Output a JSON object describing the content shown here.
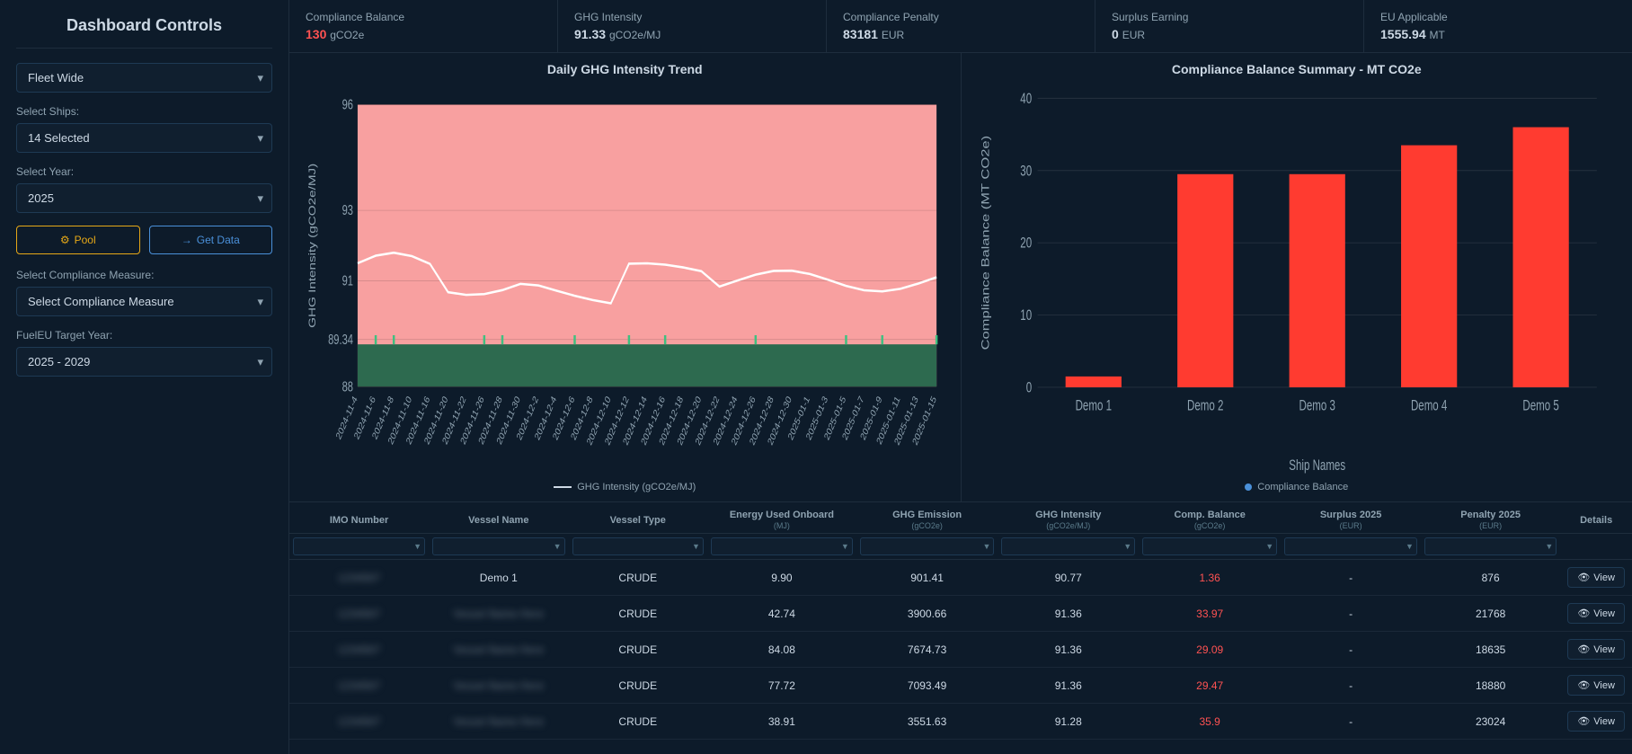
{
  "sidebar": {
    "title": "Dashboard Controls",
    "fleet_label": "Fleet Wide",
    "ships_label": "Select Ships:",
    "ships_value": "14 Selected",
    "year_label": "Select Year:",
    "year_value": "2025",
    "btn_pool": "Pool",
    "btn_getdata": "Get Data",
    "compliance_label": "Select Compliance Measure:",
    "compliance_placeholder": "Select Compliance Measure",
    "fueleu_label": "FuelEU Target Year:",
    "fueleu_value": "2025 - 2029"
  },
  "kpis": [
    {
      "title": "Compliance Balance",
      "value": "130",
      "value_color": "red",
      "unit": "gCO2e"
    },
    {
      "title": "GHG Intensity",
      "value": "91.33",
      "value_color": "normal",
      "unit": "gCO2e/MJ"
    },
    {
      "title": "Compliance Penalty",
      "value": "83181",
      "value_color": "normal",
      "unit": "EUR"
    },
    {
      "title": "Surplus Earning",
      "value": "0",
      "value_color": "normal",
      "unit": "EUR"
    },
    {
      "title": "EU Applicable",
      "value": "1555.94",
      "value_color": "normal",
      "unit": "MT"
    }
  ],
  "chart1": {
    "title": "Daily GHG Intensity Trend",
    "legend": "GHG Intensity (gCO2e/MJ)",
    "y_axis_label": "GHG Intensity (gCO2e/MJ)",
    "y_values": [
      96,
      93,
      91,
      89.34,
      88
    ],
    "x_dates": [
      "2024-11-4",
      "2024-11-6",
      "2024-11-8",
      "2024-11-10",
      "2024-11-16",
      "2024-11-20",
      "2024-11-22",
      "2024-11-26",
      "2024-11-28",
      "2024-11-30",
      "2024-12-2",
      "2024-12-4",
      "2024-12-6",
      "2024-12-8",
      "2024-12-10",
      "2024-12-12",
      "2024-12-14",
      "2024-12-16",
      "2024-12-18",
      "2024-12-20",
      "2024-12-22",
      "2024-12-24",
      "2024-12-26",
      "2024-12-28",
      "2024-12-30",
      "2025-01-1",
      "2025-01-3",
      "2025-01-5",
      "2025-01-7",
      "2025-01-9",
      "2025-01-11",
      "2025-01-13",
      "2025-01-15"
    ]
  },
  "chart2": {
    "title": "Compliance Balance Summary - MT CO2e",
    "legend": "Compliance Balance",
    "y_axis_label": "Compliance Balance (MT CO2e)",
    "ships": [
      "Demo 1",
      "Demo 2",
      "Demo 3",
      "Demo 4",
      "Demo 5"
    ],
    "values": [
      1.5,
      29.5,
      29.5,
      33.5,
      36
    ]
  },
  "table": {
    "columns": [
      {
        "header": "IMO Number",
        "sub": ""
      },
      {
        "header": "Vessel Name",
        "sub": ""
      },
      {
        "header": "Vessel Type",
        "sub": ""
      },
      {
        "header": "Energy Used Onboard",
        "sub": "(MJ)"
      },
      {
        "header": "GHG Emission",
        "sub": "(gCO2e)"
      },
      {
        "header": "GHG Intensity",
        "sub": "(gCO2e/MJ)"
      },
      {
        "header": "Comp. Balance",
        "sub": "(gCO2e)"
      },
      {
        "header": "Surplus 2025",
        "sub": "(EUR)"
      },
      {
        "header": "Penalty 2025",
        "sub": "(EUR)"
      },
      {
        "header": "Details",
        "sub": ""
      }
    ],
    "rows": [
      {
        "imo": "BLURRED1",
        "vessel": "Demo 1",
        "type": "CRUDE",
        "energy": "9.90",
        "ghg_emission": "901.41",
        "ghg_intensity": "90.77",
        "comp_balance": "1.36",
        "comp_balance_color": "red",
        "surplus": "-",
        "penalty": "876",
        "view": "View"
      },
      {
        "imo": "BLURRED2",
        "vessel": "BLURRED_VESSEL",
        "type": "CRUDE",
        "energy": "42.74",
        "ghg_emission": "3900.66",
        "ghg_intensity": "91.36",
        "comp_balance": "33.97",
        "comp_balance_color": "red",
        "surplus": "-",
        "penalty": "21768",
        "view": "View"
      },
      {
        "imo": "BLURRED3",
        "vessel": "BLURRED_VESSEL",
        "type": "CRUDE",
        "energy": "84.08",
        "ghg_emission": "7674.73",
        "ghg_intensity": "91.36",
        "comp_balance": "29.09",
        "comp_balance_color": "red",
        "surplus": "-",
        "penalty": "18635",
        "view": "View"
      },
      {
        "imo": "BLURRED4",
        "vessel": "BLURRED_VESSEL",
        "type": "CRUDE",
        "energy": "77.72",
        "ghg_emission": "7093.49",
        "ghg_intensity": "91.36",
        "comp_balance": "29.47",
        "comp_balance_color": "red",
        "surplus": "-",
        "penalty": "18880",
        "view": "View"
      },
      {
        "imo": "BLURRED5",
        "vessel": "BLURRED_VESSEL",
        "type": "CRUDE",
        "energy": "38.91",
        "ghg_emission": "3551.63",
        "ghg_intensity": "91.28",
        "comp_balance": "35.9",
        "comp_balance_color": "red",
        "surplus": "-",
        "penalty": "23024",
        "view": "View"
      }
    ]
  },
  "icons": {
    "gear": "⚙",
    "arrow": "→",
    "chevron": "▾",
    "eye": "👁",
    "filter": "▼"
  }
}
